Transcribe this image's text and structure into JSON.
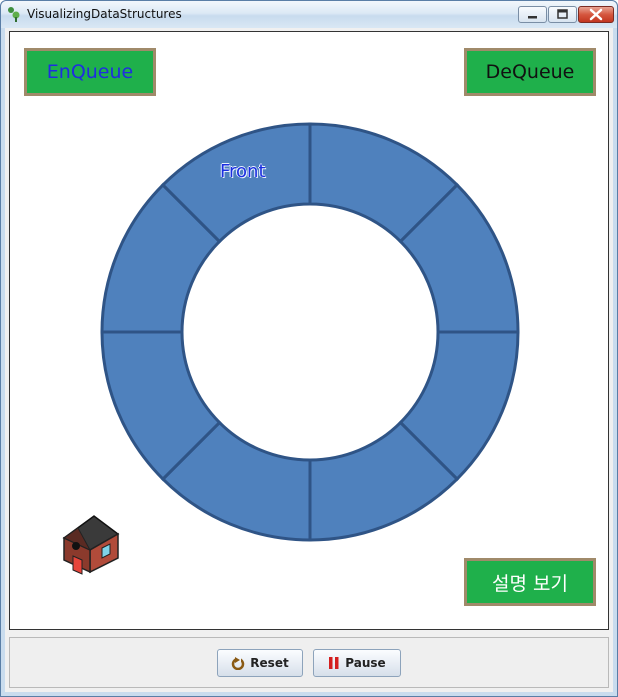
{
  "window": {
    "title": "VisualizingDataStructures"
  },
  "buttons": {
    "enqueue": "EnQueue",
    "dequeue": "DeQueue",
    "explain": "설명 보기"
  },
  "queue": {
    "front_label": "Front",
    "slot_count": 8
  },
  "controls": {
    "reset": "Reset",
    "pause": "Pause"
  },
  "colors": {
    "ring_fill": "#4f81bd",
    "ring_stroke": "#2f5486",
    "button_green": "#1fb04b",
    "button_border": "#a08a6a"
  },
  "icons": [
    "app-icon",
    "house-icon",
    "reset-icon",
    "pause-icon",
    "minimize-icon",
    "maximize-icon",
    "close-icon"
  ]
}
